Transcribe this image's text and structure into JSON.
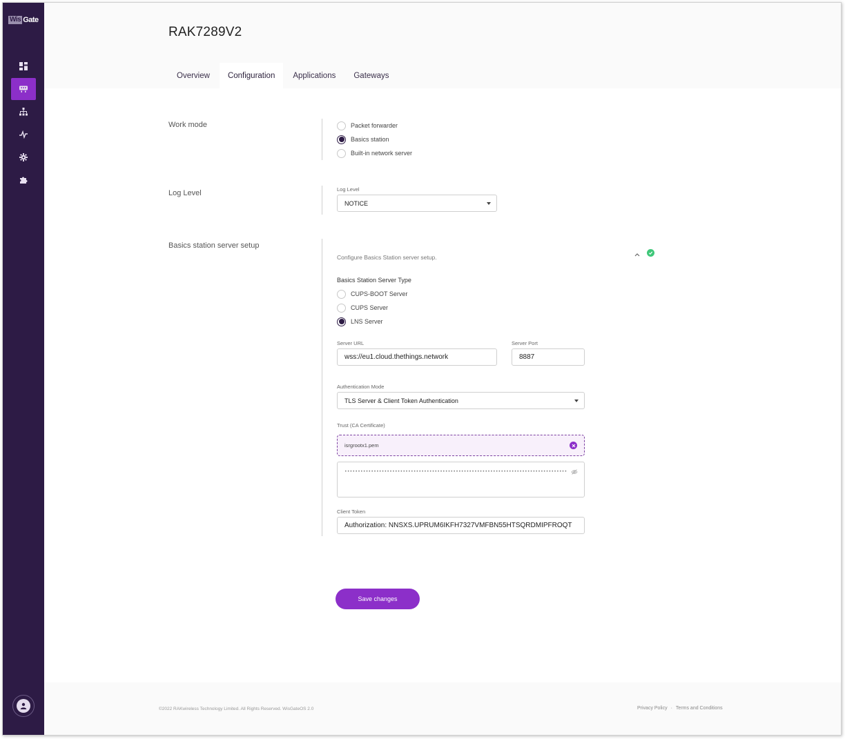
{
  "logo": {
    "part1": "Wis",
    "part2": "Gate"
  },
  "sidebar": {
    "items": [
      {
        "name": "dashboard-icon"
      },
      {
        "name": "gateway-icon"
      },
      {
        "name": "network-icon"
      },
      {
        "name": "activity-icon"
      },
      {
        "name": "gear-icon"
      },
      {
        "name": "puzzle-icon"
      }
    ],
    "active_index": 1
  },
  "header": {
    "title": "RAK7289V2",
    "tabs": [
      "Overview",
      "Configuration",
      "Applications",
      "Gateways"
    ],
    "active_tab": "Configuration"
  },
  "work_mode": {
    "label": "Work mode",
    "options": [
      "Packet forwarder",
      "Basics station",
      "Built-in network server"
    ],
    "selected": "Basics station"
  },
  "log_level": {
    "label": "Log Level",
    "field_label": "Log Level",
    "value": "NOTICE"
  },
  "basics": {
    "label": "Basics station server setup",
    "description": "Configure Basics Station server setup.",
    "server_type_label": "Basics Station Server Type",
    "server_types": [
      "CUPS-BOOT Server",
      "CUPS Server",
      "LNS Server"
    ],
    "selected_server_type": "LNS Server",
    "server_url_label": "Server URL",
    "server_url": "wss://eu1.cloud.thethings.network",
    "server_port_label": "Server Port",
    "server_port": "8887",
    "auth_mode_label": "Authentication Mode",
    "auth_mode": "TLS Server & Client Token Authentication",
    "trust_label": "Trust (CA Certificate)",
    "trust_file": "isrgrootx1.pem",
    "trust_masked": "••••••••••••••••••••••••••••••••••••••••••••••••••••••••••••••••••••••••••••••••••••",
    "client_token_label": "Client Token",
    "client_token": "Authorization: NNSXS.UPRUM6IKFH7327VMFBN55HTSQRDMIPFROQT"
  },
  "actions": {
    "save_label": "Save changes"
  },
  "footer": {
    "copyright": "©2022 RAKwireless Technology Limited. All Rights Reserved. WisGateOS 2.0",
    "privacy": "Privacy Policy",
    "separator": "·",
    "terms": "Terms and Conditions"
  },
  "colors": {
    "sidebar_bg": "#2d1b45",
    "accent": "#8c2fc9",
    "success": "#3fc779"
  }
}
